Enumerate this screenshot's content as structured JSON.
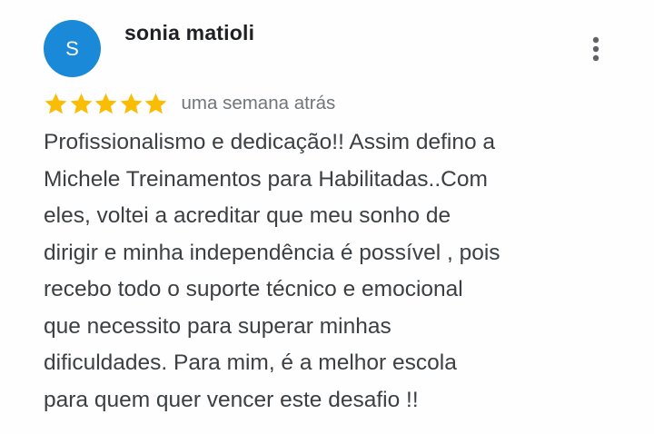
{
  "review": {
    "avatar_letter": "S",
    "avatar_color": "#1a8ad8",
    "author_name": "sonia matioli",
    "more_icon": "more-vertical-icon",
    "rating": 5,
    "rating_max": 5,
    "star_icon": "star-icon",
    "star_color": "#fbbc04",
    "timestamp": "uma semana atrás",
    "text": "Profissionalismo e dedicação!! Assim defino a\nMichele Treinamentos para Habilitadas..Com\neles, voltei a acreditar que meu sonho de\ndirigir e minha independência é possível , pois\nrecebo todo o suporte técnico e emocional\nque necessito para superar minhas\ndificuldades. Para mim, é a melhor  escola\npara quem quer vencer este desafio !!"
  }
}
